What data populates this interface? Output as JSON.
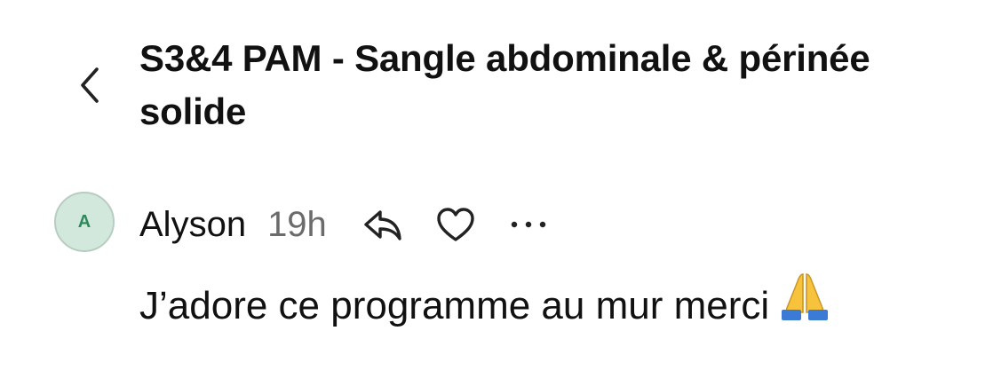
{
  "header": {
    "title": "S3&4 PAM - Sangle abdominale & périnée solide",
    "back_icon": "chevron-left-icon"
  },
  "comment": {
    "avatar_initial": "A",
    "avatar_bg": "#d3e8dd",
    "avatar_fg": "#2e8a5b",
    "author": "Alyson",
    "time": "19h",
    "actions": {
      "reply_icon": "reply-icon",
      "like_icon": "heart-icon",
      "more_icon": "more-horizontal-icon"
    },
    "text": "J’adore ce programme au mur merci",
    "emoji_icon": "folded-hands-emoji"
  }
}
